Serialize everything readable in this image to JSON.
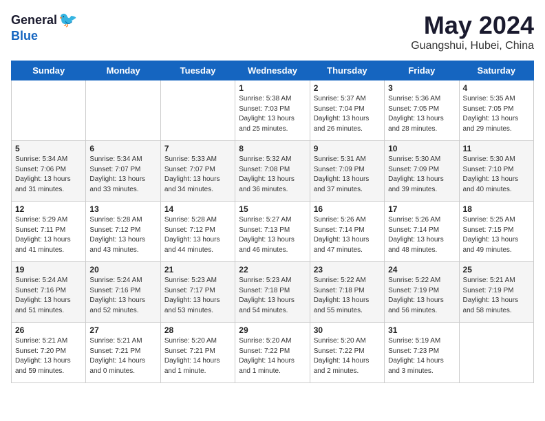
{
  "logo": {
    "general": "General",
    "blue": "Blue"
  },
  "title": "May 2024",
  "location": "Guangshui, Hubei, China",
  "headers": [
    "Sunday",
    "Monday",
    "Tuesday",
    "Wednesday",
    "Thursday",
    "Friday",
    "Saturday"
  ],
  "weeks": [
    [
      {
        "day": "",
        "info": ""
      },
      {
        "day": "",
        "info": ""
      },
      {
        "day": "",
        "info": ""
      },
      {
        "day": "1",
        "info": "Sunrise: 5:38 AM\nSunset: 7:03 PM\nDaylight: 13 hours\nand 25 minutes."
      },
      {
        "day": "2",
        "info": "Sunrise: 5:37 AM\nSunset: 7:04 PM\nDaylight: 13 hours\nand 26 minutes."
      },
      {
        "day": "3",
        "info": "Sunrise: 5:36 AM\nSunset: 7:05 PM\nDaylight: 13 hours\nand 28 minutes."
      },
      {
        "day": "4",
        "info": "Sunrise: 5:35 AM\nSunset: 7:05 PM\nDaylight: 13 hours\nand 29 minutes."
      }
    ],
    [
      {
        "day": "5",
        "info": "Sunrise: 5:34 AM\nSunset: 7:06 PM\nDaylight: 13 hours\nand 31 minutes."
      },
      {
        "day": "6",
        "info": "Sunrise: 5:34 AM\nSunset: 7:07 PM\nDaylight: 13 hours\nand 33 minutes."
      },
      {
        "day": "7",
        "info": "Sunrise: 5:33 AM\nSunset: 7:07 PM\nDaylight: 13 hours\nand 34 minutes."
      },
      {
        "day": "8",
        "info": "Sunrise: 5:32 AM\nSunset: 7:08 PM\nDaylight: 13 hours\nand 36 minutes."
      },
      {
        "day": "9",
        "info": "Sunrise: 5:31 AM\nSunset: 7:09 PM\nDaylight: 13 hours\nand 37 minutes."
      },
      {
        "day": "10",
        "info": "Sunrise: 5:30 AM\nSunset: 7:09 PM\nDaylight: 13 hours\nand 39 minutes."
      },
      {
        "day": "11",
        "info": "Sunrise: 5:30 AM\nSunset: 7:10 PM\nDaylight: 13 hours\nand 40 minutes."
      }
    ],
    [
      {
        "day": "12",
        "info": "Sunrise: 5:29 AM\nSunset: 7:11 PM\nDaylight: 13 hours\nand 41 minutes."
      },
      {
        "day": "13",
        "info": "Sunrise: 5:28 AM\nSunset: 7:12 PM\nDaylight: 13 hours\nand 43 minutes."
      },
      {
        "day": "14",
        "info": "Sunrise: 5:28 AM\nSunset: 7:12 PM\nDaylight: 13 hours\nand 44 minutes."
      },
      {
        "day": "15",
        "info": "Sunrise: 5:27 AM\nSunset: 7:13 PM\nDaylight: 13 hours\nand 46 minutes."
      },
      {
        "day": "16",
        "info": "Sunrise: 5:26 AM\nSunset: 7:14 PM\nDaylight: 13 hours\nand 47 minutes."
      },
      {
        "day": "17",
        "info": "Sunrise: 5:26 AM\nSunset: 7:14 PM\nDaylight: 13 hours\nand 48 minutes."
      },
      {
        "day": "18",
        "info": "Sunrise: 5:25 AM\nSunset: 7:15 PM\nDaylight: 13 hours\nand 49 minutes."
      }
    ],
    [
      {
        "day": "19",
        "info": "Sunrise: 5:24 AM\nSunset: 7:16 PM\nDaylight: 13 hours\nand 51 minutes."
      },
      {
        "day": "20",
        "info": "Sunrise: 5:24 AM\nSunset: 7:16 PM\nDaylight: 13 hours\nand 52 minutes."
      },
      {
        "day": "21",
        "info": "Sunrise: 5:23 AM\nSunset: 7:17 PM\nDaylight: 13 hours\nand 53 minutes."
      },
      {
        "day": "22",
        "info": "Sunrise: 5:23 AM\nSunset: 7:18 PM\nDaylight: 13 hours\nand 54 minutes."
      },
      {
        "day": "23",
        "info": "Sunrise: 5:22 AM\nSunset: 7:18 PM\nDaylight: 13 hours\nand 55 minutes."
      },
      {
        "day": "24",
        "info": "Sunrise: 5:22 AM\nSunset: 7:19 PM\nDaylight: 13 hours\nand 56 minutes."
      },
      {
        "day": "25",
        "info": "Sunrise: 5:21 AM\nSunset: 7:19 PM\nDaylight: 13 hours\nand 58 minutes."
      }
    ],
    [
      {
        "day": "26",
        "info": "Sunrise: 5:21 AM\nSunset: 7:20 PM\nDaylight: 13 hours\nand 59 minutes."
      },
      {
        "day": "27",
        "info": "Sunrise: 5:21 AM\nSunset: 7:21 PM\nDaylight: 14 hours\nand 0 minutes."
      },
      {
        "day": "28",
        "info": "Sunrise: 5:20 AM\nSunset: 7:21 PM\nDaylight: 14 hours\nand 1 minute."
      },
      {
        "day": "29",
        "info": "Sunrise: 5:20 AM\nSunset: 7:22 PM\nDaylight: 14 hours\nand 1 minute."
      },
      {
        "day": "30",
        "info": "Sunrise: 5:20 AM\nSunset: 7:22 PM\nDaylight: 14 hours\nand 2 minutes."
      },
      {
        "day": "31",
        "info": "Sunrise: 5:19 AM\nSunset: 7:23 PM\nDaylight: 14 hours\nand 3 minutes."
      },
      {
        "day": "",
        "info": ""
      }
    ]
  ]
}
